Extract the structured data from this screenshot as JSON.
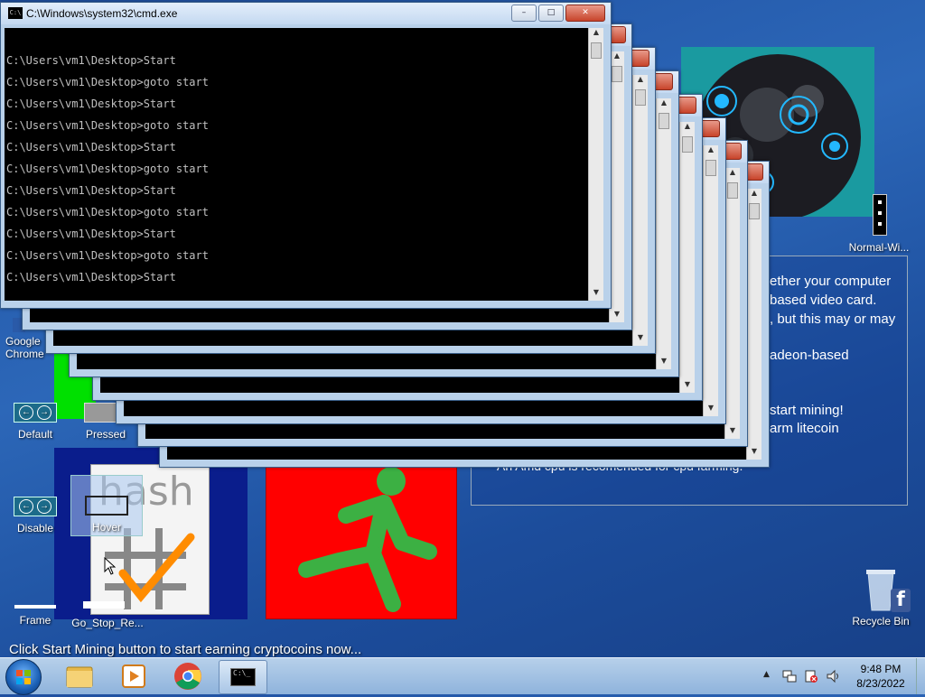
{
  "cmd_window": {
    "title": "C:\\Windows\\system32\\cmd.exe",
    "lines": [
      "C:\\Users\\vm1\\Desktop>Start",
      "C:\\Users\\vm1\\Desktop>goto start",
      "C:\\Users\\vm1\\Desktop>Start",
      "C:\\Users\\vm1\\Desktop>goto start",
      "C:\\Users\\vm1\\Desktop>Start",
      "C:\\Users\\vm1\\Desktop>goto start",
      "C:\\Users\\vm1\\Desktop>Start",
      "C:\\Users\\vm1\\Desktop>goto start",
      "C:\\Users\\vm1\\Desktop>Start",
      "C:\\Users\\vm1\\Desktop>goto start",
      "C:\\Users\\vm1\\Desktop>Start"
    ],
    "minimize": "–",
    "maximize": "□",
    "close": "✕"
  },
  "desktop_icons": {
    "chrome": "Google Chrome",
    "default": "Default",
    "pressed": "Pressed",
    "disable": "Disable",
    "hover": "Hover",
    "frame": "Frame",
    "go_stop": "Go_Stop_Re...",
    "normal_wi": "Normal-Wi...",
    "recycle_bin": "Recycle Bin",
    "hash_word": "hash"
  },
  "info_panel": {
    "lines": [
      "ether your computer",
      "based video card.",
      ", but this may or may",
      "adeon-based",
      "start mining!",
      "arm litecoin",
      "An Amd cpu is recomended for cpu farming."
    ]
  },
  "status_text": "Click Start Mining button to start earning cryptocoins now...",
  "taskbar": {
    "time": "9:48 PM",
    "date": "8/23/2022",
    "cmd_icon": "C:\\_",
    "tray_arrow": "▲"
  },
  "colors": {
    "desktop_blue": "#2c67b8",
    "green_runner_bg": "#ff0000",
    "runner": "#3cb043"
  }
}
